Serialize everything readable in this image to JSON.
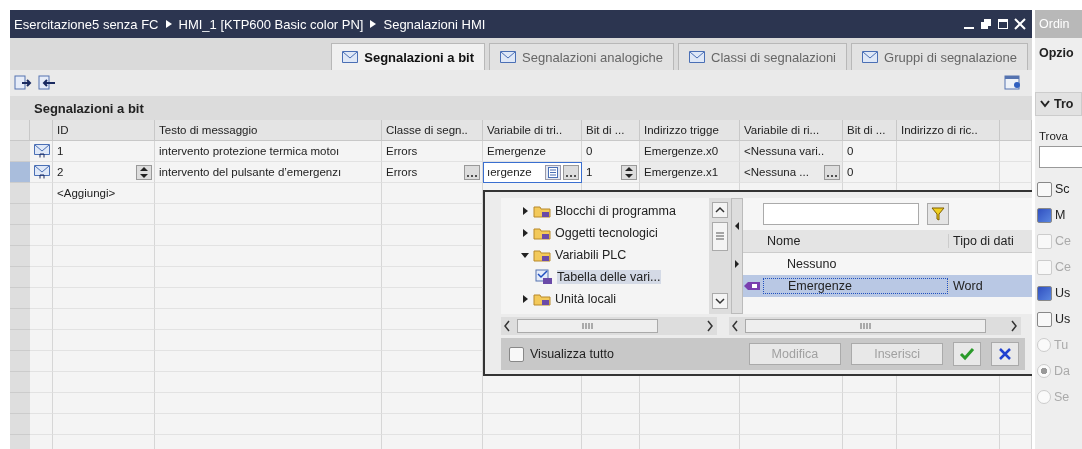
{
  "breadcrumb": [
    "Esercitazione5 senza FC",
    "HMI_1 [KTP600 Basic color PN]",
    "Segnalazioni HMI"
  ],
  "tabs": [
    {
      "label": "Segnalazioni a bit",
      "selected": true
    },
    {
      "label": "Segnalazioni analogiche",
      "selected": false
    },
    {
      "label": "Classi di segnalazioni",
      "selected": false
    },
    {
      "label": "Gruppi di segnalazione",
      "selected": false
    }
  ],
  "section_title": "Segnalazioni a bit",
  "columns": [
    "ID",
    "Testo di messaggio",
    "Classe di segn..",
    "Variabile di tri..",
    "Bit di ...",
    "Indirizzo trigge",
    "Variabile di ri...",
    "Bit di ...",
    "Indirizzo di ric.."
  ],
  "rows": [
    {
      "id": "1",
      "text": "intervento protezione termica motoı",
      "class": "Errors",
      "trigger_var": "Emergenze",
      "bit": "0",
      "trigger_address": "Emergenze.x0",
      "ack_var": "<Nessuna vari..",
      "ack_bit": "0",
      "editing": false
    },
    {
      "id": "2",
      "text": "intervento del pulsante d’emergenzı",
      "class": "Errors",
      "trigger_var": "ıergenze",
      "bit": "1",
      "trigger_address": "Emergenze.x1",
      "ack_var": "<Nessuna ...",
      "ack_bit": "0",
      "editing": true
    }
  ],
  "add_row": "<Aggiungi>",
  "popup": {
    "tree": [
      {
        "label": "Blocchi di programma",
        "expanded": false,
        "selected": false
      },
      {
        "label": "Oggetti tecnologici",
        "expanded": false,
        "selected": false
      },
      {
        "label": "Variabili PLC",
        "expanded": true,
        "selected": false,
        "children": [
          {
            "label": "Tabella delle vari...",
            "selected": true
          }
        ]
      },
      {
        "label": "Unità locali",
        "expanded": false,
        "selected": false
      }
    ],
    "columns": [
      "Nome",
      "Tipo di dati"
    ],
    "items": [
      {
        "name": "Nessuno",
        "selected": false
      },
      {
        "name": "Emergenze",
        "type": "Word",
        "selected": true
      }
    ],
    "show_all": {
      "label": "Visualizza tutto",
      "checked": false
    },
    "buttons": [
      {
        "label": "Modifica",
        "disabled": true
      },
      {
        "label": "Inserisci",
        "disabled": true
      }
    ]
  },
  "side": {
    "title": "Ordin",
    "options_title": "Opzio",
    "section": "Tro",
    "find_label": "Trova",
    "options": [
      {
        "kind": "checkbox",
        "label": "Sc",
        "checked": false,
        "disabled": false
      },
      {
        "kind": "checkbox",
        "label": "M",
        "checked": true,
        "disabled": false
      },
      {
        "kind": "checkbox",
        "label": "Ce",
        "checked": false,
        "disabled": true
      },
      {
        "kind": "checkbox",
        "label": "Ce",
        "checked": false,
        "disabled": true
      },
      {
        "kind": "checkbox",
        "label": "Us",
        "checked": true,
        "disabled": false
      },
      {
        "kind": "checkbox",
        "label": "Us",
        "checked": false,
        "disabled": false
      },
      {
        "kind": "radio",
        "label": "Tu",
        "checked": false,
        "disabled": true
      },
      {
        "kind": "radio",
        "label": "Da",
        "checked": true,
        "disabled": true
      },
      {
        "kind": "radio",
        "label": "Se",
        "checked": false,
        "disabled": true
      }
    ]
  }
}
